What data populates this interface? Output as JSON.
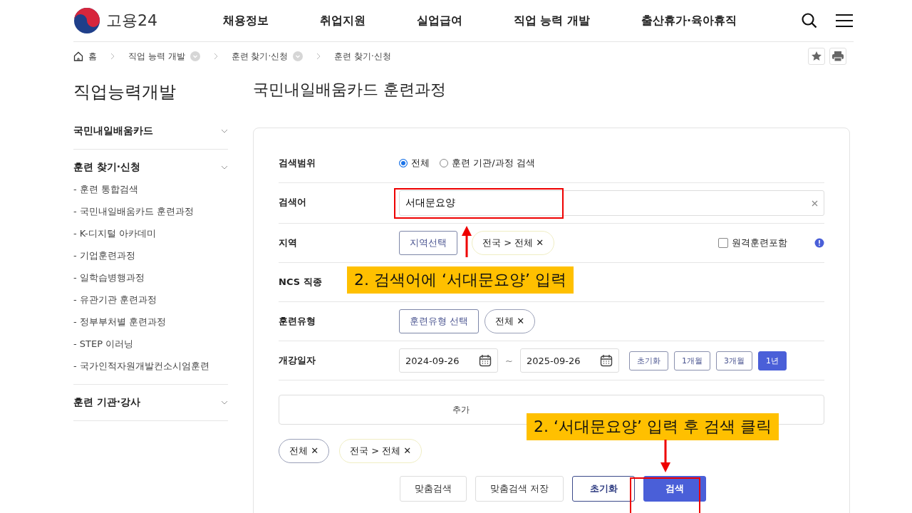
{
  "header": {
    "logo": "고용24",
    "nav": [
      "채용정보",
      "취업지원",
      "실업급여",
      "직업 능력 개발",
      "출산휴가·육아휴직"
    ]
  },
  "breadcrumb": [
    {
      "label": "홈",
      "kind": "home"
    },
    {
      "label": "직업 능력 개발",
      "kind": "menu"
    },
    {
      "label": "훈련 찾기·신청",
      "kind": "menu"
    },
    {
      "label": "훈련 찾기·신청",
      "kind": "plain"
    }
  ],
  "sidebar": {
    "title": "직업능력개발",
    "sections": [
      {
        "label": "국민내일배움카드"
      },
      {
        "label": "훈련 찾기·신청",
        "children": [
          "- 훈련 통합검색",
          "- 국민내일배움카드 훈련과정",
          "- K-디지털 아카데미",
          "- 기업훈련과정",
          "- 일학습병행과정",
          "- 유관기관 훈련과정",
          "- 정부부처별 훈련과정",
          "- STEP 이러닝",
          "- 국가인적자원개발컨소시엄훈련"
        ]
      },
      {
        "label": "훈련 기관·강사"
      }
    ]
  },
  "page_title": "국민내일배움카드 훈련과정",
  "form": {
    "rows": [
      {
        "kind": "radio",
        "label": "검색범위",
        "options": [
          {
            "label": "전체",
            "selected": true
          },
          {
            "label": "훈련 기관/과정 검색",
            "selected": false
          }
        ]
      },
      {
        "kind": "text",
        "label": "검색어",
        "value": "서대문요양"
      },
      {
        "kind": "region",
        "label": "지역",
        "button": "지역선택",
        "chip": "전국 > 전체 ✕",
        "checkbox": {
          "label": "원격훈련포함",
          "checked": false
        }
      },
      {
        "kind": "ncs",
        "label": "NCS 직종"
      },
      {
        "kind": "type",
        "label": "훈련유형",
        "button": "훈련유형 선택",
        "chip": "전체 ✕"
      },
      {
        "kind": "date",
        "label": "개강일자",
        "from": "2024-09-26",
        "to": "2025-09-26",
        "separator": "~",
        "periods": [
          {
            "label": "초기화",
            "selected": false
          },
          {
            "label": "1개월",
            "selected": false
          },
          {
            "label": "3개월",
            "selected": false
          },
          {
            "label": "1년",
            "selected": true
          }
        ]
      }
    ],
    "more": "추가",
    "chips": [
      {
        "label": "전체 ✕",
        "kind": "type"
      },
      {
        "label": "전국 > 전체 ✕",
        "kind": "region"
      }
    ],
    "buttons": [
      {
        "label": "맞춤검색",
        "kind": "plain"
      },
      {
        "label": "맞춤검색 저장",
        "kind": "plain"
      },
      {
        "label": "초기화",
        "kind": "outline"
      },
      {
        "label": "검색",
        "kind": "primary"
      }
    ]
  },
  "annotations": [
    {
      "text": "2. 검색어에 ‘서대문요양’ 입력"
    },
    {
      "text": "2. ‘서대문요양’ 입력 후 검색 클릭"
    }
  ]
}
